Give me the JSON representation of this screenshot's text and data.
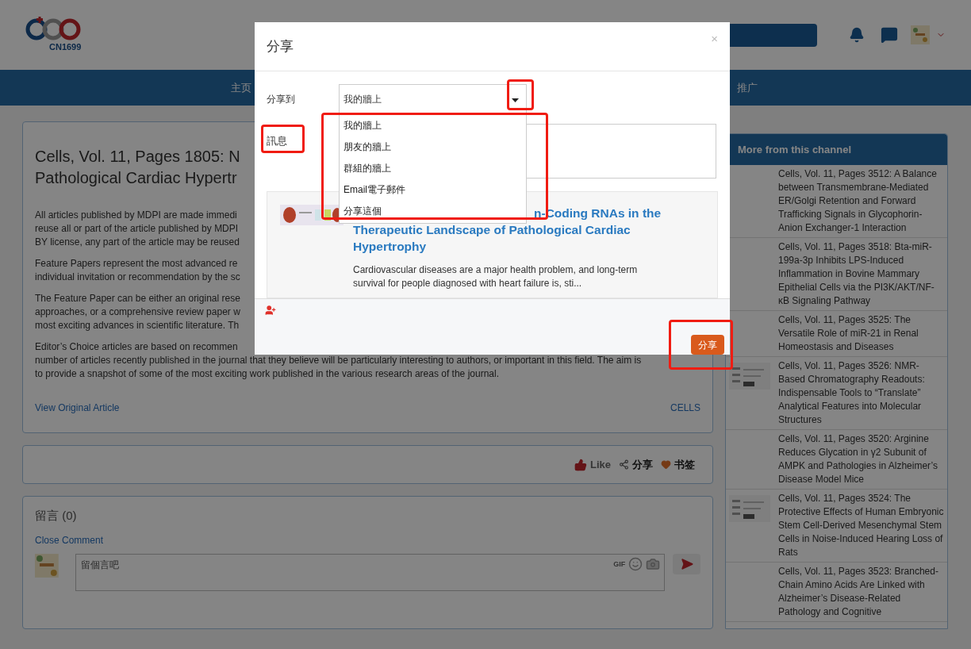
{
  "header": {
    "logo_text": "CN1699"
  },
  "nav": {
    "items": [
      "主页",
      "推广"
    ]
  },
  "article": {
    "title_lines": [
      "Cells, Vol. 11, Pages 1805: N",
      "Pathological Cardiac Hypertr"
    ],
    "paragraphs": [
      [
        "All articles published by MDPI are made immedi",
        "reuse all or part of the article published by MDPI",
        "BY license, any part of the article may be reused"
      ],
      [
        "Feature Papers represent the most advanced re",
        "individual invitation or recommendation by the sc"
      ],
      [
        "The Feature Paper can be either an original rese",
        "approaches, or a comprehensive review paper w",
        "most exciting advances in scientific literature. Th"
      ],
      [
        "Editor’s Choice articles are based on recommen",
        "number of articles recently published in the journal that they believe will be particularly interesting to authors, or important in this field. The aim is",
        "to provide a snapshot of some of the most exciting work published in the various research areas of the journal."
      ]
    ],
    "link": "View Original Article",
    "journal": "CELLS"
  },
  "actions": [
    {
      "kind": "like",
      "label": "Like"
    },
    {
      "kind": "share",
      "label": "分享"
    },
    {
      "kind": "bookmark",
      "label": "书签"
    }
  ],
  "comments": {
    "title": "留言 (0)",
    "toggle": "Close Comment",
    "placeholder": "留個言吧",
    "gif": "GIF"
  },
  "sidebar": {
    "title": "More from this channel",
    "items": [
      {
        "title": "Cells, Vol. 11, Pages 3512: A Balance between Transmembrane-Mediated ER/Golgi Retention and Forward Trafficking Signals in Glycophorin-Anion Exchanger-1 Interaction",
        "has_thumbnail": false
      },
      {
        "title": "Cells, Vol. 11, Pages 3518: Bta-miR-199a-3p Inhibits LPS-Induced Inflammation in Bovine Mammary Epithelial Cells via the PI3K/AKT/NF-κB Signaling Pathway",
        "has_thumbnail": false
      },
      {
        "title": "Cells, Vol. 11, Pages 3525: The Versatile Role of miR-21 in Renal Homeostasis and Diseases",
        "has_thumbnail": false
      },
      {
        "title": "Cells, Vol. 11, Pages 3526: NMR-Based Chromatography Readouts: Indispensable Tools to “Translate” Analytical Features into Molecular Structures",
        "has_thumbnail": true
      },
      {
        "title": "Cells, Vol. 11, Pages 3520: Arginine Reduces Glycation in γ2 Subunit of AMPK and Pathologies in Alzheimer’s Disease Model Mice",
        "has_thumbnail": false
      },
      {
        "title": "Cells, Vol. 11, Pages 3524: The Protective Effects of Human Embryonic Stem Cell-Derived Mesenchymal Stem Cells in Noise-Induced Hearing Loss of Rats",
        "has_thumbnail": true
      },
      {
        "title": "Cells, Vol. 11, Pages 3523: Branched-Chain Amino Acids Are Linked with Alzheimer’s Disease-Related Pathology and Cognitive",
        "has_thumbnail": false
      }
    ]
  },
  "dialog": {
    "title": "分享",
    "close": "×",
    "share_to_label": "分享到",
    "share_to_value": "我的牆上",
    "options": [
      "我的牆上",
      "朋友的牆上",
      "群組的牆上",
      "Email電子郵件",
      "分享這個"
    ],
    "message_label": "訊息",
    "preview": {
      "title_lines": [
        "n-Coding RNAs in the",
        "Therapeutic Landscape of Pathological Cardiac",
        "Hypertrophy"
      ],
      "description": "Cardiovascular diseases are a major health problem, and long-term survival for people diagnosed with heart failure is, sti..."
    },
    "submit": "分享"
  }
}
